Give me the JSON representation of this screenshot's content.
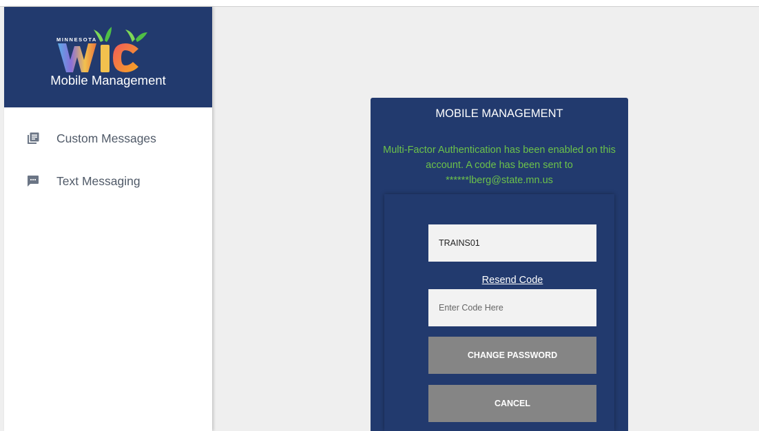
{
  "sidebar": {
    "logo": {
      "state": "MINNESOTA",
      "word": "WIC"
    },
    "app_title": "Mobile Management",
    "items": [
      {
        "label": "Custom Messages",
        "icon": "list-document-icon"
      },
      {
        "label": "Text Messaging",
        "icon": "chat-bubble-icon"
      }
    ]
  },
  "login": {
    "title": "MOBILE MANAGEMENT",
    "message": "Multi-Factor Authentication has been enabled on this account. A code has been sent to ******lberg@state.mn.us",
    "username_value": "TRAINS01",
    "resend_label": "Resend Code",
    "code_placeholder": "Enter Code Here",
    "change_password_label": "CHANGE PASSWORD",
    "cancel_label": "CANCEL"
  },
  "colors": {
    "brand_navy": "#223a6e",
    "message_green": "#6cc24a",
    "button_gray": "#858585",
    "background": "#efefef"
  }
}
